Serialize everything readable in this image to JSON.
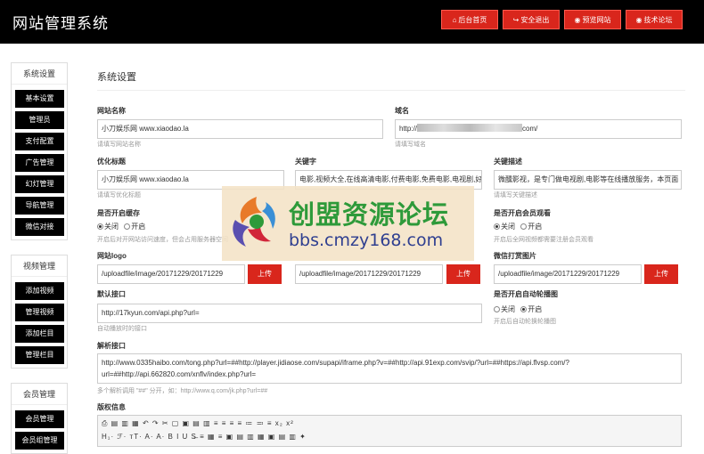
{
  "header": {
    "title": "网站管理系统",
    "buttons": [
      {
        "icon": "home-icon",
        "glyph": "⌂",
        "label": "后台首页"
      },
      {
        "icon": "logout-icon",
        "glyph": "↪",
        "label": "安全退出"
      },
      {
        "icon": "eye-icon",
        "glyph": "◉",
        "label": "预览网站"
      },
      {
        "icon": "eye-icon",
        "glyph": "◉",
        "label": "技术论坛"
      }
    ]
  },
  "sidebar": {
    "sections": [
      {
        "title": "系统设置",
        "items": [
          "基本设置",
          "管理员",
          "支付配置",
          "广告管理",
          "幻灯管理",
          "导航管理",
          "微信对接"
        ]
      },
      {
        "title": "视频管理",
        "items": [
          "添加视频",
          "管理视频",
          "添加栏目",
          "管理栏目"
        ]
      },
      {
        "title": "会员管理",
        "items": [
          "会员管理",
          "会员组管理"
        ]
      }
    ]
  },
  "main": {
    "title": "系统设置",
    "site_name": {
      "label": "网站名称",
      "value": "小刀娱乐网 www.xiaodao.la",
      "hint": "请填写网站名称"
    },
    "domain": {
      "label": "域名",
      "prefix": "http://",
      "suffix": "com/",
      "hint": "请填写域名"
    },
    "seo_title": {
      "label": "优化标题",
      "value": "小刀娱乐网 www.xiaodao.la",
      "hint": "请填写优化标题"
    },
    "keywords": {
      "label": "关键字",
      "value": "电影,视频大全,在线高清电影,付费电影,免费电影,电视剧,好看的电影,最新电影"
    },
    "description": {
      "label": "关键描述",
      "value": "微醺影视，是专门做电视剧,电影等在线播放服务，本页面",
      "hint": "请填写关键描述"
    },
    "cache": {
      "label": "是否开启缓存",
      "off": "关闭",
      "on": "开启",
      "selected": "off",
      "hint": "开启后对开网站访问速度，但会占用服务器空间"
    },
    "member_view": {
      "label": "是否开启会员观看",
      "off": "关闭",
      "on": "开启",
      "selected": "off",
      "hint": "开启后全网视频都需要注册会员观看"
    },
    "logo": {
      "label": "网站logo",
      "value": "/uploadfile/image/20171229/20171229",
      "button": "上传"
    },
    "upload2": {
      "value": "/uploadfile/image/20171229/20171229",
      "button": "上传"
    },
    "wechat_pic": {
      "label": "微信打赏图片",
      "value": "/uploadfile/image/20171229/20171229",
      "button": "上传"
    },
    "default_api": {
      "label": "默认接口",
      "value": "http://17kyun.com/api.php?url=",
      "hint": "自动播放时的接口"
    },
    "autoplay": {
      "label": "是否开启自动轮播图",
      "off": "关闭",
      "on": "开启",
      "selected": "on",
      "hint": "开启后自动轮换轮播图"
    },
    "parse_api": {
      "label": "解析接口",
      "line1": "http://www.0335haibo.com/tong.php?url=##http://player.jidiaose.com/supapi/iframe.php?v=##http://api.91exp.com/svip/?url=##https://api.flvsp.com/?",
      "line2": "url=##http://api.662820.com/xnflv/index.php?url=",
      "hint": "多个解析调用 \"##\" 分开，如：http://www.q.com/jk.php?url=##"
    },
    "copyright": {
      "label": "版权信息",
      "row1": "⎙ ▤ ▥ ▦  ↶ ↷  ✂ ▢ ▣ ▤ ▥  ≡ ≡ ≡ ≡  ≔ ≕ ≡  x₂ x²",
      "row2": "H₁· ℱ· ᴛT·  A· A·  B  I  U  S̶  ≡  ▦ ≡ ▣ ▤ ▥ ▦ ▣ ▤ ▥  ✦"
    }
  },
  "watermark": {
    "title": "创盟资源论坛",
    "url": "bbs.cmzy168.com"
  },
  "colors": {
    "header_bg": "#000000",
    "accent_red": "#d9261c",
    "sidebar_button": "#000000",
    "watermark_green": "#2e9a3a",
    "watermark_blue": "#2f3f90"
  }
}
